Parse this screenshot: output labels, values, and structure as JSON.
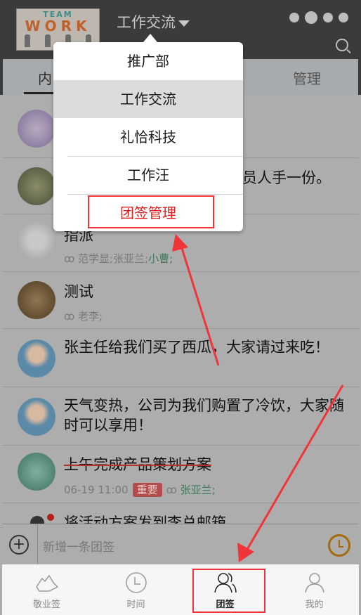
{
  "header": {
    "logo_top": "TEAM",
    "logo_main": "WORK",
    "title": "工作交流"
  },
  "tabs": {
    "first": "内",
    "manage": "管理"
  },
  "popup": {
    "items": [
      {
        "label": "推广部"
      },
      {
        "label": "工作交流"
      },
      {
        "label": "礼恰科技"
      },
      {
        "label": "工作汪"
      },
      {
        "label": "团签管理"
      }
    ]
  },
  "list": {
    "rows": [
      {
        "text": ""
      },
      {
        "text": "员人手一份。"
      },
      {
        "text": "指派",
        "members": "范学显;张亚兰;",
        "members_green": "小曹;"
      },
      {
        "text": "测试",
        "members": "老李;"
      },
      {
        "text": "张主任给我们买了西瓜，大家请过来吃！"
      },
      {
        "text": "天气变热，公司为我们购置了冷饮，大家随时可以享用！"
      },
      {
        "text": "上午完成产品策划方案",
        "time": "06-19 11:00",
        "badge": "重要",
        "members_green": "张亚兰;"
      },
      {
        "text": "将活动方案发到李总邮箱"
      }
    ]
  },
  "input": {
    "placeholder": "新增一条团签"
  },
  "nav": {
    "items": [
      {
        "label": "敬业签"
      },
      {
        "label": "时间"
      },
      {
        "label": "团签"
      },
      {
        "label": "我的"
      }
    ]
  },
  "colors": {
    "accent_red": "#f0353a",
    "clock": "#a6690b",
    "header": "#3b3b3b"
  }
}
